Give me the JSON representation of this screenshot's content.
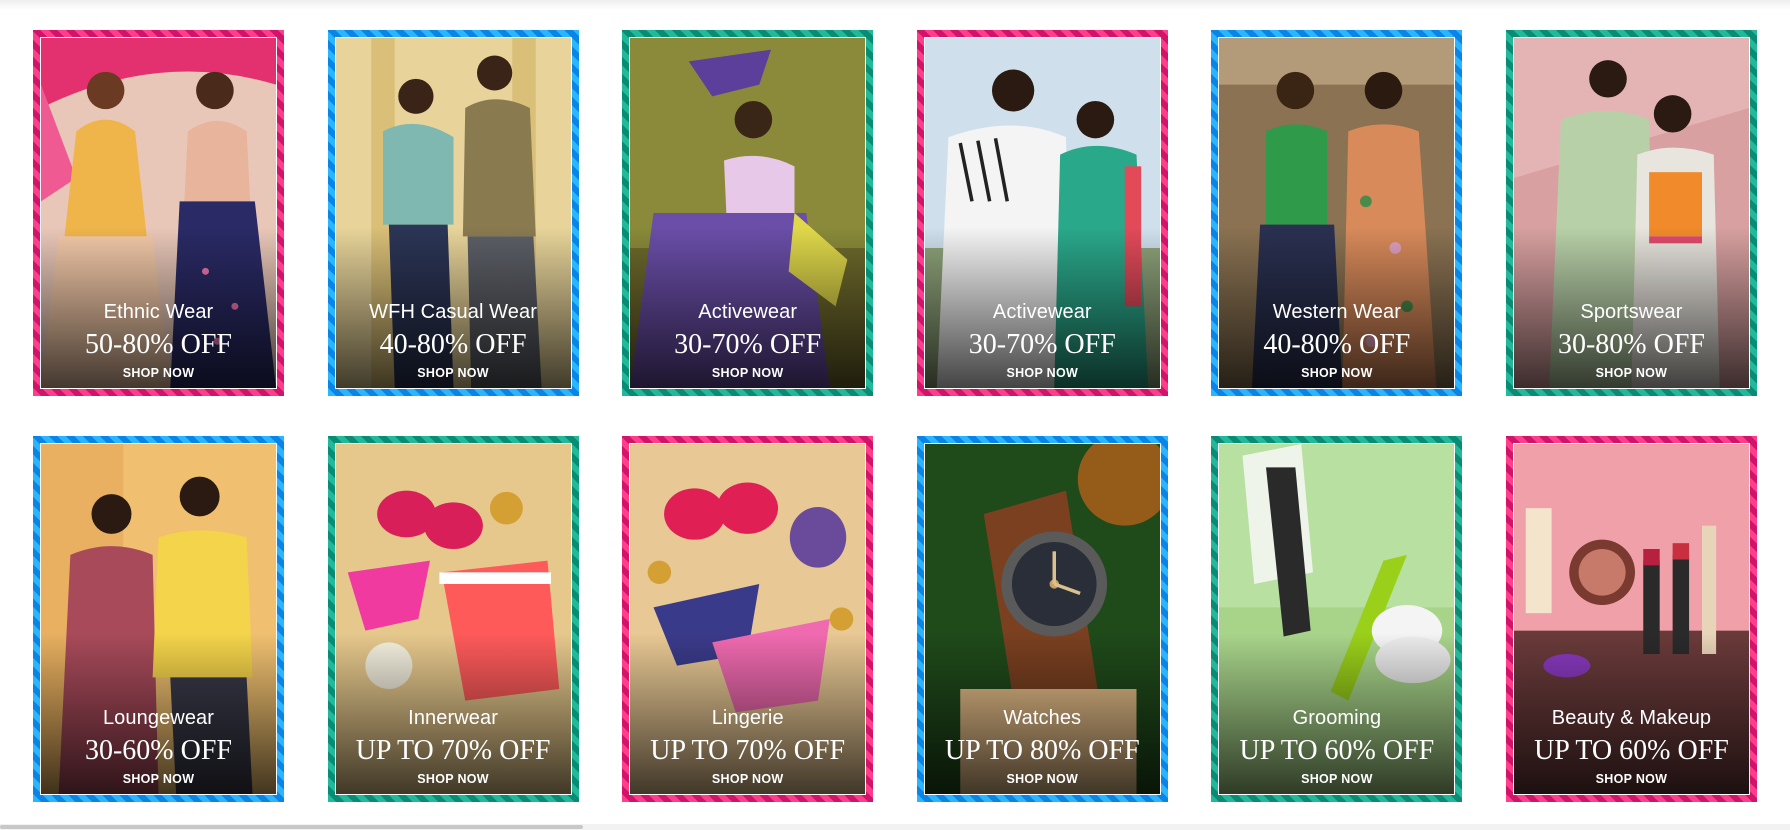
{
  "cta_label": "SHOP NOW",
  "frame_colors": {
    "pink": "#e8287a",
    "blue": "#1a9bf0",
    "teal": "#159f84"
  },
  "cards": [
    {
      "category": "Ethnic Wear",
      "offer": "50-80% OFF",
      "frame": "pink"
    },
    {
      "category": "WFH Casual Wear",
      "offer": "40-80% OFF",
      "frame": "blue"
    },
    {
      "category": "Activewear",
      "offer": "30-70% OFF",
      "frame": "teal"
    },
    {
      "category": "Activewear",
      "offer": "30-70% OFF",
      "frame": "pink"
    },
    {
      "category": "Western Wear",
      "offer": "40-80% OFF",
      "frame": "blue"
    },
    {
      "category": "Sportswear",
      "offer": "30-80% OFF",
      "frame": "teal"
    },
    {
      "category": "Loungewear",
      "offer": "30-60% OFF",
      "frame": "blue"
    },
    {
      "category": "Innerwear",
      "offer": "UP TO 70% OFF",
      "frame": "teal"
    },
    {
      "category": "Lingerie",
      "offer": "UP TO 70% OFF",
      "frame": "pink"
    },
    {
      "category": "Watches",
      "offer": "UP TO 80% OFF",
      "frame": "blue"
    },
    {
      "category": "Grooming",
      "offer": "UP TO 60% OFF",
      "frame": "teal"
    },
    {
      "category": "Beauty & Makeup",
      "offer": "UP TO 60% OFF",
      "frame": "pink"
    }
  ]
}
